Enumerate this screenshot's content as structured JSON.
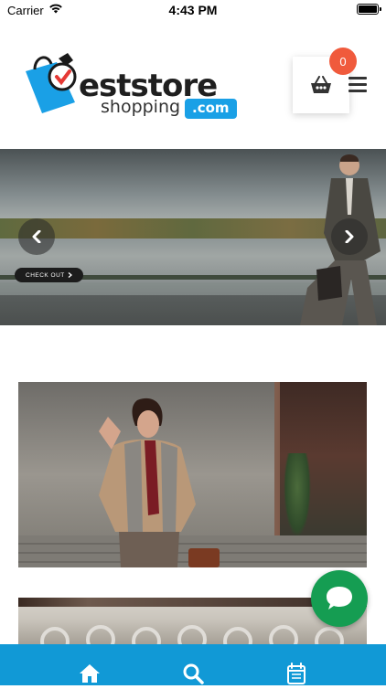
{
  "status_bar": {
    "carrier": "Carrier",
    "time": "4:43 PM"
  },
  "header": {
    "logo": {
      "text_main": "eststore",
      "text_sub": "shopping",
      "text_com": ".com"
    },
    "cart": {
      "count": "0",
      "icon": "basket-icon"
    },
    "menu_icon": "hamburger-menu-icon"
  },
  "banner": {
    "checkout_label": "CHECK OUT",
    "prev_icon": "chevron-left-icon",
    "next_icon": "chevron-right-icon"
  },
  "chat": {
    "icon": "chat-bubble-icon",
    "color": "#159d52"
  },
  "bottom_nav": {
    "color": "#1199d6",
    "items": [
      {
        "icon": "home-icon"
      },
      {
        "icon": "search-icon"
      },
      {
        "icon": "calendar-icon"
      }
    ]
  },
  "colors": {
    "cart_badge": "#f05a3c",
    "logo_blue": "#1aa0e6"
  }
}
